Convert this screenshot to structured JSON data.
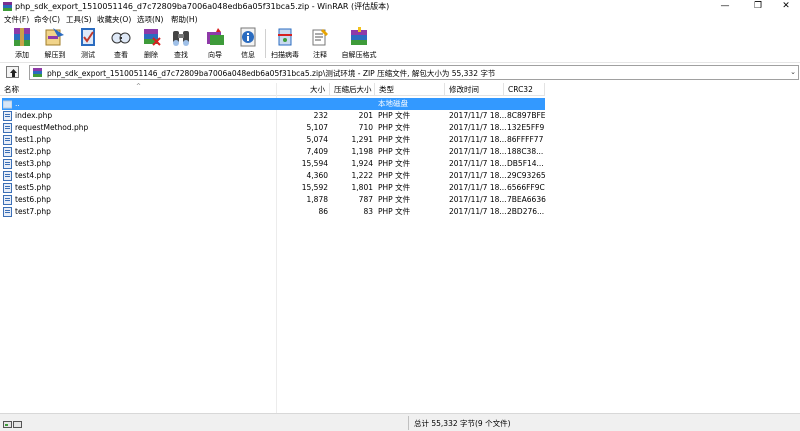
{
  "window": {
    "title": "php_sdk_export_1510051146_d7c72809ba7006a048edb6a05f31bca5.zip - WinRAR (评估版本)",
    "minimize": "—",
    "maximize": "❐",
    "close": "✕"
  },
  "menu": [
    "文件(F)",
    "命令(C)",
    "工具(S)",
    "收藏夹(O)",
    "选项(N)",
    "帮助(H)"
  ],
  "toolbar": [
    {
      "id": "add",
      "label": "添加",
      "icon": "add-archive-icon"
    },
    {
      "id": "extract",
      "label": "解压到",
      "icon": "extract-to-icon"
    },
    {
      "id": "test",
      "label": "测试",
      "icon": "test-icon"
    },
    {
      "id": "view",
      "label": "查看",
      "icon": "view-icon"
    },
    {
      "id": "delete",
      "label": "删除",
      "icon": "delete-icon"
    },
    {
      "id": "find",
      "label": "查找",
      "icon": "find-icon"
    },
    {
      "id": "wizard",
      "label": "向导",
      "icon": "wizard-icon"
    },
    {
      "id": "info",
      "label": "信息",
      "icon": "info-icon"
    },
    {
      "id": "scan",
      "label": "扫描病毒",
      "icon": "scan-virus-icon"
    },
    {
      "id": "comment",
      "label": "注释",
      "icon": "comment-icon"
    },
    {
      "id": "sfx",
      "label": "自解压格式",
      "icon": "sfx-icon"
    }
  ],
  "address": {
    "path": "php_sdk_export_1510051146_d7c72809ba7006a048edb6a05f31bca5.zip\\测试环境 - ZIP 压缩文件, 解包大小为 55,332 字节",
    "dropdown": "⌄"
  },
  "columns": {
    "name": "名称",
    "size": "大小",
    "packed": "压缩后大小",
    "type": "类型",
    "modified": "修改时间",
    "crc": "CRC32",
    "sort_indicator": "^"
  },
  "parent_row": {
    "name": "..",
    "type": "本地磁盘"
  },
  "files": [
    {
      "name": "index.php",
      "size": "232",
      "packed": "201",
      "type": "PHP 文件",
      "modified": "2017/11/7 18...",
      "crc": "8C897BFE"
    },
    {
      "name": "requestMethod.php",
      "size": "5,107",
      "packed": "710",
      "type": "PHP 文件",
      "modified": "2017/11/7 18...",
      "crc": "132E5FF9"
    },
    {
      "name": "test1.php",
      "size": "5,074",
      "packed": "1,291",
      "type": "PHP 文件",
      "modified": "2017/11/7 18...",
      "crc": "86FFFF77"
    },
    {
      "name": "test2.php",
      "size": "7,409",
      "packed": "1,198",
      "type": "PHP 文件",
      "modified": "2017/11/7 18...",
      "crc": "188C38..."
    },
    {
      "name": "test3.php",
      "size": "15,594",
      "packed": "1,924",
      "type": "PHP 文件",
      "modified": "2017/11/7 18...",
      "crc": "DB5F14..."
    },
    {
      "name": "test4.php",
      "size": "4,360",
      "packed": "1,222",
      "type": "PHP 文件",
      "modified": "2017/11/7 18...",
      "crc": "29C93265"
    },
    {
      "name": "test5.php",
      "size": "15,592",
      "packed": "1,801",
      "type": "PHP 文件",
      "modified": "2017/11/7 18...",
      "crc": "6566FF9C"
    },
    {
      "name": "test6.php",
      "size": "1,878",
      "packed": "787",
      "type": "PHP 文件",
      "modified": "2017/11/7 18...",
      "crc": "7BEA6636"
    },
    {
      "name": "test7.php",
      "size": "86",
      "packed": "83",
      "type": "PHP 文件",
      "modified": "2017/11/7 18...",
      "crc": "2BD276..."
    }
  ],
  "status": {
    "summary": "总计 55,332 字节(9 个文件)"
  },
  "colors": {
    "selection": "#3399ff",
    "php_icon": "#3b6fb6"
  }
}
